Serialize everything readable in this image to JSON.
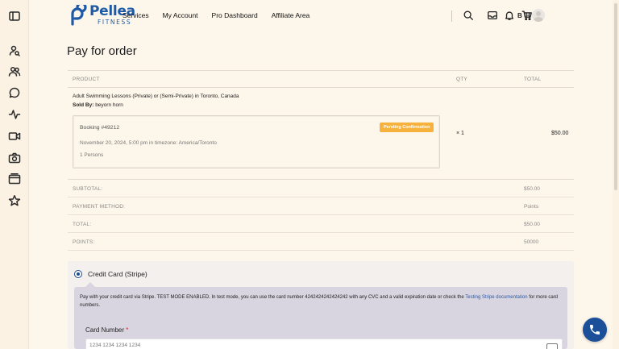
{
  "brand": {
    "name": "Pellea",
    "subtitle": "FITNESS",
    "color": "#1e5aa8"
  },
  "sidebar": {
    "icons": [
      "sidebar-toggle-icon",
      "user-search-icon",
      "users-icon",
      "chat-icon",
      "activity-icon",
      "video-icon",
      "camera-icon",
      "folder-icon",
      "star-icon"
    ]
  },
  "nav": {
    "items": [
      "Services",
      "My Account",
      "Pro Dashboard",
      "Affiliate Area"
    ]
  },
  "header": {
    "icons": [
      "search-icon",
      "inbox-icon",
      "bell-icon",
      "cart-icon"
    ],
    "user_initials": "B H"
  },
  "page": {
    "title": "Pay for order"
  },
  "table": {
    "headers": {
      "product": "PRODUCT",
      "qty": "QTY",
      "total": "TOTAL"
    },
    "item": {
      "name": "Adult Swimming Lessons (Private) or (Semi-Private) in Toronto, Canada",
      "sold_by_label": "Sold By:",
      "sold_by_value": "beyorn horn",
      "booking_title": "Booking #49212",
      "booking_status": "Pending Confirmation",
      "booking_date": "November 20, 2024, 5:00 pm in timezone: America/Toronto",
      "persons": "1 Persons",
      "qty": "× 1",
      "total": "$50.00"
    }
  },
  "summary": [
    {
      "label": "SUBTOTAL:",
      "value": "$50.00"
    },
    {
      "label": "PAYMENT METHOD:",
      "value": "Points"
    },
    {
      "label": "TOTAL:",
      "value": "$50.00"
    },
    {
      "label": "POINTS:",
      "value": "50000"
    }
  ],
  "payment": {
    "method_label": "Credit Card (Stripe)",
    "description": "Pay with your credit card via Stripe. TEST MODE ENABLED. In test mode, you can use the card number 4242424242424242 with any CVC and a valid expiration date or check the ",
    "link_text": "Testing Stripe documentation",
    "description_tail": " for more card numbers.",
    "card_label": "Card Number",
    "required_mark": "*",
    "card_placeholder": "1234 1234 1234 1234"
  },
  "colors": {
    "accent": "#1b4f9a",
    "badge": "#f6b23c",
    "background": "#fdf6ea"
  }
}
